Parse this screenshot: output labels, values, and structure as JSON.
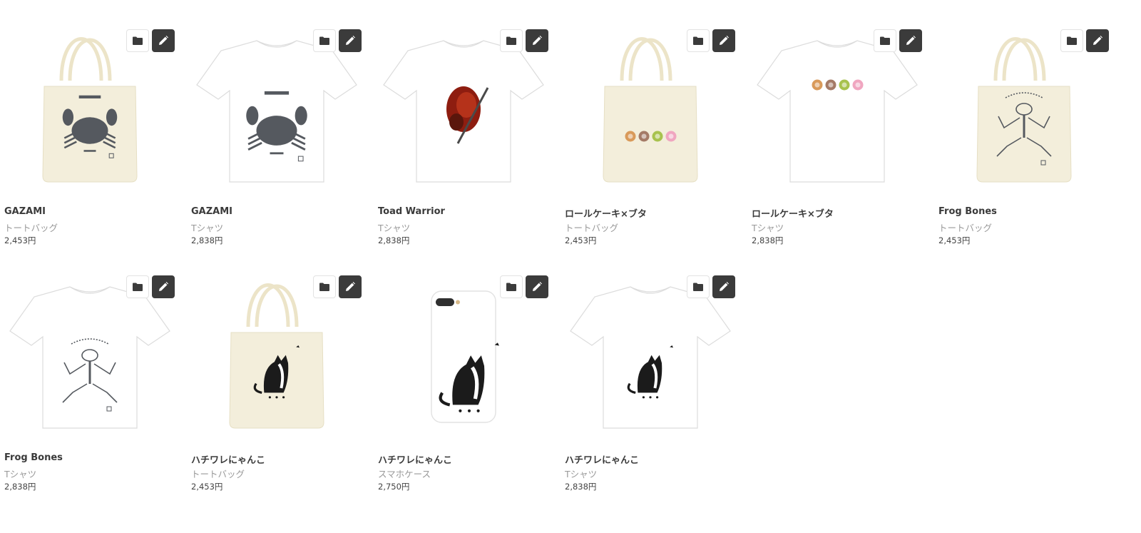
{
  "products": [
    {
      "title": "GAZAMI",
      "kind": "トートバッグ",
      "price": "2,453円",
      "item": "tote",
      "design": "crab",
      "folder_icon": "folder-icon",
      "edit_icon": "pencil-icon"
    },
    {
      "title": "GAZAMI",
      "kind": "Tシャツ",
      "price": "2,838円",
      "item": "tshirt",
      "design": "crab",
      "folder_icon": "folder-icon",
      "edit_icon": "pencil-icon"
    },
    {
      "title": "Toad Warrior",
      "kind": "Tシャツ",
      "price": "2,838円",
      "item": "tshirt",
      "design": "warrior",
      "folder_icon": "folder-icon",
      "edit_icon": "pencil-icon"
    },
    {
      "title": "ロールケーキ×ブタ",
      "kind": "トートバッグ",
      "price": "2,453円",
      "item": "tote",
      "design": "pigs",
      "folder_icon": "folder-icon",
      "edit_icon": "pencil-icon"
    },
    {
      "title": "ロールケーキ×ブタ",
      "kind": "Tシャツ",
      "price": "2,838円",
      "item": "tshirt",
      "design": "pigs",
      "folder_icon": "folder-icon",
      "edit_icon": "pencil-icon"
    },
    {
      "title": "Frog Bones",
      "kind": "トートバッグ",
      "price": "2,453円",
      "item": "tote",
      "design": "frog",
      "folder_icon": "folder-icon",
      "edit_icon": "pencil-icon"
    },
    {
      "title": "Frog Bones",
      "kind": "Tシャツ",
      "price": "2,838円",
      "item": "tshirt",
      "design": "frog",
      "folder_icon": "folder-icon",
      "edit_icon": "pencil-icon"
    },
    {
      "title": "ハチワレにゃんこ",
      "kind": "トートバッグ",
      "price": "2,453円",
      "item": "tote",
      "design": "cat",
      "folder_icon": "folder-icon",
      "edit_icon": "pencil-icon"
    },
    {
      "title": "ハチワレにゃんこ",
      "kind": "スマホケース",
      "price": "2,750円",
      "item": "phone",
      "design": "cat",
      "folder_icon": "folder-icon",
      "edit_icon": "pencil-icon"
    },
    {
      "title": "ハチワレにゃんこ",
      "kind": "Tシャツ",
      "price": "2,838円",
      "item": "tshirt",
      "design": "cat",
      "folder_icon": "folder-icon",
      "edit_icon": "pencil-icon"
    }
  ],
  "colors": {
    "tote": "#f3eedb",
    "tote_edge": "#e6dfc4",
    "handle": "#ece4c8",
    "tshirt": "#ffffff",
    "tshirt_edge": "#dcdcdc",
    "phone": "#ffffff",
    "edit_button": "#3b3b3b",
    "folder_button": "#ffffff"
  }
}
